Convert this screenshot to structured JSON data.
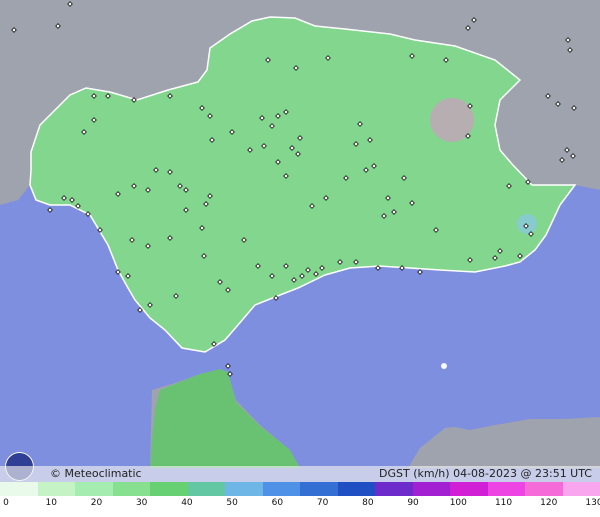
{
  "brand": {
    "copyright_text": "© Meteoclimatic"
  },
  "product": {
    "label": "DGST (km/h)  04-08-2023 @ 23:51 UTC"
  },
  "legend": {
    "ticks": [
      "0",
      "10",
      "20",
      "30",
      "40",
      "50",
      "60",
      "70",
      "80",
      "90",
      "100",
      "110",
      "120",
      "130"
    ],
    "colors": [
      "#eafaea",
      "#c6f3c6",
      "#a4ecb0",
      "#86e08f",
      "#67d073",
      "#63c7a3",
      "#6eb6e6",
      "#4f91e6",
      "#346fd3",
      "#1f4fc3",
      "#6d2bcb",
      "#a220d2",
      "#d11fd6",
      "#ed45e3",
      "#f56bd8",
      "#f9a6ee"
    ]
  },
  "colors": {
    "sea": "#7f8fe0",
    "land_main": "#83d68d",
    "land_deep": "#68c272",
    "outside_land": "#9ea3ae",
    "border": "#ffffff",
    "station_fill": "#ffffff",
    "station_stroke": "#111111"
  }
}
